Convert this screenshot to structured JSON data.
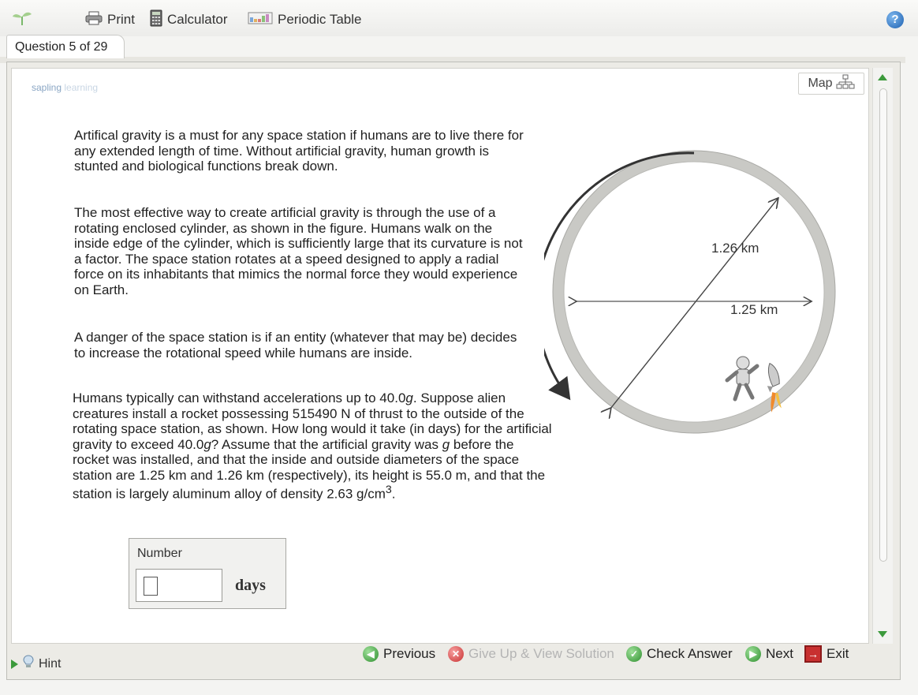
{
  "toolbar": {
    "print_label": "Print",
    "calculator_label": "Calculator",
    "periodic_table_label": "Periodic Table"
  },
  "question_tab": "Question 5 of 29",
  "brand": {
    "name": "sapling",
    "suffix": "learning"
  },
  "map_label": "Map",
  "question": {
    "p1": "Artifical gravity is a must for any space station if humans are to live there for any extended length of time. Without artificial gravity, human growth is stunted and biological functions break down.",
    "p2": "The most effective way to create artificial gravity is through the use of a rotating enclosed cylinder, as shown in the figure. Humans walk on the inside edge of the cylinder, which is sufficiently large that its curvature is not a factor. The space station rotates at a speed designed to apply a radial force on its inhabitants that mimics the normal force they would experience on Earth.",
    "p3": "A danger of the space station is if an entity (whatever that may be) decides to increase the rotational speed while humans are inside.",
    "p4_a": "Humans typically can withstand accelerations up to 40.0",
    "p4_g1": "g",
    "p4_b": ". Suppose alien creatures install a rocket possessing 515490 N of thrust to the outside of the rotating space station, as shown. How long would it take (in days) for the artificial gravity to exceed 40.0",
    "p4_g2": "g",
    "p4_c": "? Assume that the artificial gravity was ",
    "p4_g3": "g",
    "p4_d": " before the rocket was installed, and that the inside and outside diameters of the space station are 1.25 km and 1.26 km (respectively), its height is 55.0 m, and that the station is largely aluminum alloy of density 2.63 g/cm",
    "p4_sup": "3",
    "p4_end": "."
  },
  "figure": {
    "outer_label": "1.26 km",
    "inner_label": "1.25 km"
  },
  "answer": {
    "label": "Number",
    "value": "",
    "unit": "days"
  },
  "bottom": {
    "hint": "Hint",
    "previous": "Previous",
    "give_up": "Give Up & View Solution",
    "check_answer": "Check Answer",
    "next": "Next",
    "exit": "Exit"
  },
  "colors": {
    "accent_green": "#3c9a3c",
    "help_blue": "#1c5fb0",
    "disabled_text": "#b4b4b4"
  }
}
